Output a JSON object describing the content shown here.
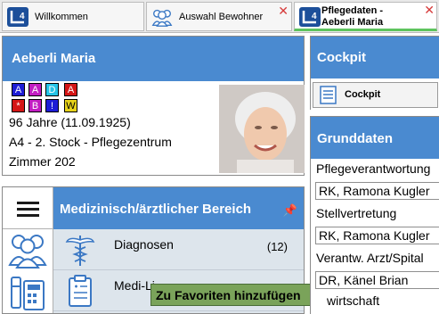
{
  "tabs": [
    {
      "label": "Willkommen",
      "icon": "app-logo-icon"
    },
    {
      "label": "Auswahl Bewohner",
      "icon": "residents-group-icon",
      "close": "✕"
    },
    {
      "label_line1": "Pflegedaten -",
      "label_line2": "Aeberli Maria",
      "icon": "app-logo-icon",
      "close": "✕",
      "active": true
    }
  ],
  "patient": {
    "name": "Aeberli Maria",
    "badges_row1": [
      {
        "text": "A",
        "color": "#1d1dd6"
      },
      {
        "text": "A",
        "color": "#c21dc2"
      },
      {
        "text": "D",
        "color": "#25c4e6"
      },
      {
        "text": "A",
        "color": "#d41616"
      }
    ],
    "badges_row2": [
      {
        "text": "*",
        "color": "#d41616"
      },
      {
        "text": "B",
        "color": "#c21dc2"
      },
      {
        "text": "!",
        "color": "#1d1dd6"
      },
      {
        "text": "W",
        "color": "#e6d21a",
        "text_color": "#000000"
      }
    ],
    "age_line": "96 Jahre (11.09.1925)",
    "location_line": "A4 - 2. Stock - Pflegezentrum",
    "room_line": "Zimmer 202"
  },
  "menu": {
    "title": "Medizinisch/ärztlicher Bereich",
    "items": [
      {
        "label": "Diagnosen",
        "count": "(12)",
        "icon": "caduceus-icon"
      },
      {
        "label": "Medi-Li",
        "count": "",
        "icon": "clipboard-icon"
      }
    ]
  },
  "tooltip": {
    "text": "Zu Favoriten hinzufügen"
  },
  "cockpit": {
    "title": "Cockpit",
    "item_label": "Cockpit"
  },
  "grunddaten": {
    "title": "Grunddaten",
    "fields": [
      {
        "label": "Pflegeverantwortung",
        "value": "RK, Ramona Kugler"
      },
      {
        "label": "Stellvertretung",
        "value": "RK, Ramona Kugler"
      },
      {
        "label": "Verantw. Arzt/Spital",
        "value": "DR, Känel Brian"
      },
      {
        "label": "wirtschaft",
        "value": ""
      }
    ]
  },
  "colors": {
    "header_blue": "#4a8ad0",
    "menu_background": "#dde5ec",
    "tooltip_green": "#7aa35a",
    "active_tab_accent": "#5ec45e",
    "close_red": "#d63a3a"
  }
}
